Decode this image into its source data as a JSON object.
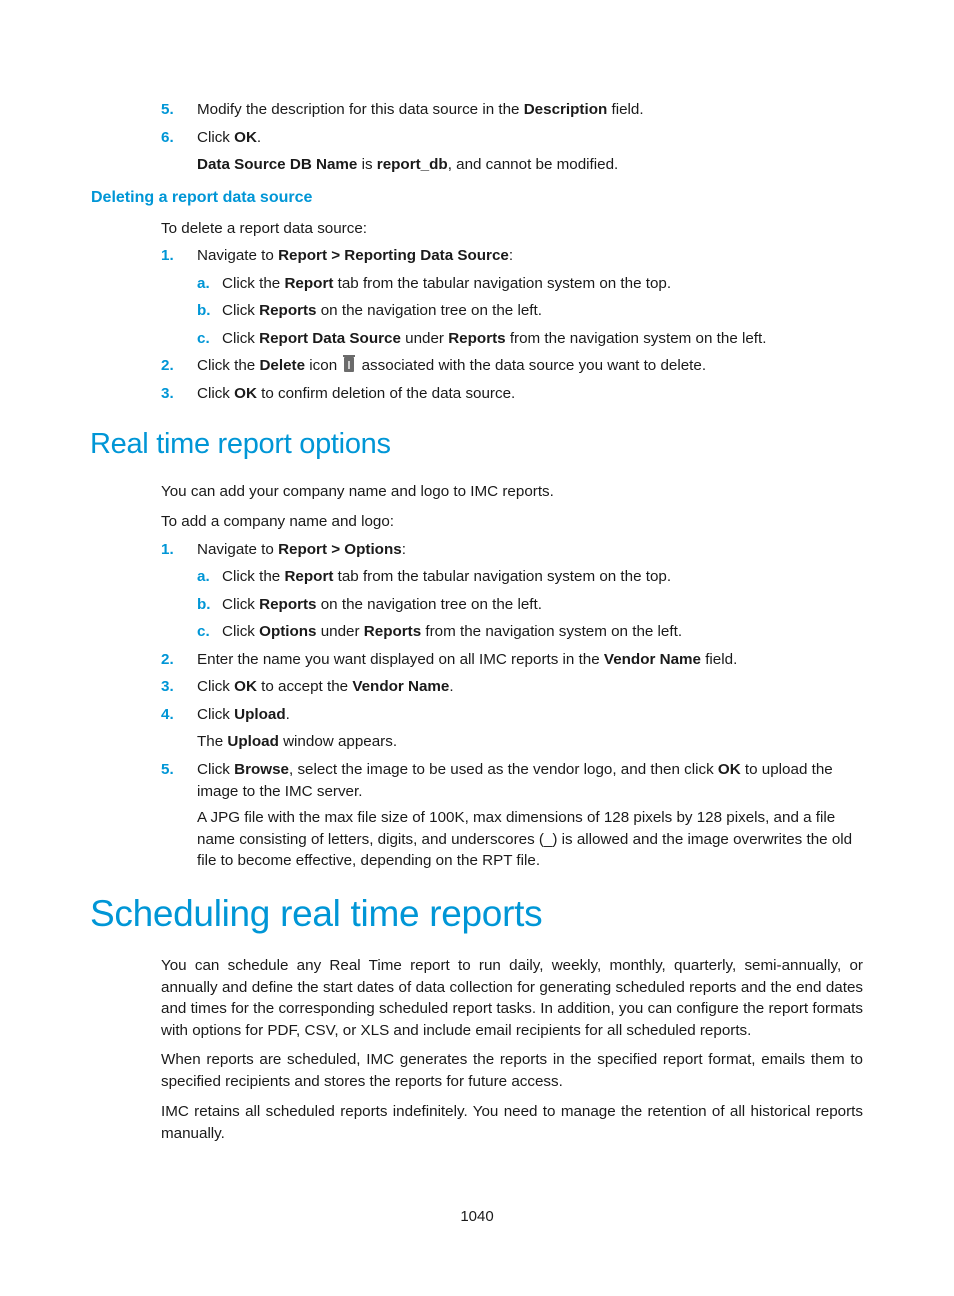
{
  "top_steps": [
    {
      "num": "5.",
      "pre": "Modify the description for this data source in the ",
      "bold": "Description",
      "post": " field."
    },
    {
      "num": "6.",
      "pre": "Click ",
      "bold": "OK",
      "post": "."
    }
  ],
  "top_note": {
    "b1": "Data Source DB Name",
    "t1": " is ",
    "b2": "report_db",
    "t2": ", and cannot be modified."
  },
  "delete_section": {
    "heading": "Deleting a report data source",
    "intro": "To delete a report data source:",
    "step1": {
      "num": "1.",
      "pre": "Navigate to ",
      "bold": "Report > Reporting Data Source",
      "post": ":"
    },
    "substeps": [
      {
        "letter": "a.",
        "pre": "Click the ",
        "b1": "Report",
        "mid": " tab from the tabular navigation system on the top.",
        "b2": "",
        "post": ""
      },
      {
        "letter": "b.",
        "pre": "Click ",
        "b1": "Reports",
        "mid": " on the navigation tree on the left.",
        "b2": "",
        "post": ""
      },
      {
        "letter": "c.",
        "pre": "Click ",
        "b1": "Report Data Source",
        "mid": " under ",
        "b2": "Reports",
        "post": " from the navigation system on the left."
      }
    ],
    "step2": {
      "num": "2.",
      "pre": "Click the ",
      "bold": "Delete",
      "mid": " icon",
      "icon": "trash-icon",
      "post": " associated with the data source you want to delete."
    },
    "step3": {
      "num": "3.",
      "pre": "Click ",
      "bold": "OK",
      "post": " to confirm deletion of the data source."
    }
  },
  "options_section": {
    "heading": "Real time report options",
    "intro1": "You can add your company name and logo to IMC reports.",
    "intro2": "To add a company name and logo:",
    "step1": {
      "num": "1.",
      "pre": "Navigate to ",
      "bold": "Report > Options",
      "post": ":"
    },
    "substeps": [
      {
        "letter": "a.",
        "pre": "Click the ",
        "b1": "Report",
        "mid": " tab from the tabular navigation system on the top.",
        "b2": "",
        "post": ""
      },
      {
        "letter": "b.",
        "pre": "Click ",
        "b1": "Reports",
        "mid": " on the navigation tree on the left.",
        "b2": "",
        "post": ""
      },
      {
        "letter": "c.",
        "pre": "Click ",
        "b1": "Options",
        "mid": " under ",
        "b2": "Reports",
        "post": " from the navigation system on the left."
      }
    ],
    "step2": {
      "num": "2.",
      "pre": "Enter the name you want displayed on all IMC reports in the ",
      "bold": "Vendor Name",
      "post": " field."
    },
    "step3": {
      "num": "3.",
      "pre": "Click ",
      "b1": "OK",
      "mid": " to accept the ",
      "b2": "Vendor Name",
      "post": "."
    },
    "step4": {
      "num": "4.",
      "pre": "Click ",
      "bold": "Upload",
      "post": "."
    },
    "step4_note": {
      "pre": "The ",
      "bold": "Upload",
      "post": " window appears."
    },
    "step5": {
      "num": "5.",
      "pre": "Click ",
      "b1": "Browse",
      "mid": ", select the image to be used as the vendor logo, and then click ",
      "b2": "OK",
      "post": " to upload the image to the IMC server."
    },
    "step5_note": "A JPG file with the max file size of 100K, max dimensions of 128 pixels by 128 pixels, and a file name consisting of letters, digits, and underscores (_) is allowed and the image overwrites the old file to become effective, depending on the RPT file."
  },
  "scheduling_section": {
    "heading": "Scheduling real time reports",
    "paragraphs": [
      "You can schedule any Real Time report to run daily, weekly, monthly, quarterly, semi-annually, or annually and define the start dates of data collection for generating scheduled reports and the end dates and times for the corresponding scheduled report tasks. In addition, you can configure the report formats with options for PDF, CSV, or XLS and include email recipients for all scheduled reports.",
      "When reports are scheduled, IMC generates the reports in the specified report format, emails them to specified recipients and stores the reports for future access.",
      "IMC retains all scheduled reports indefinitely. You need to manage the retention of all historical reports manually."
    ]
  },
  "footer": {
    "page_number": "1040"
  }
}
